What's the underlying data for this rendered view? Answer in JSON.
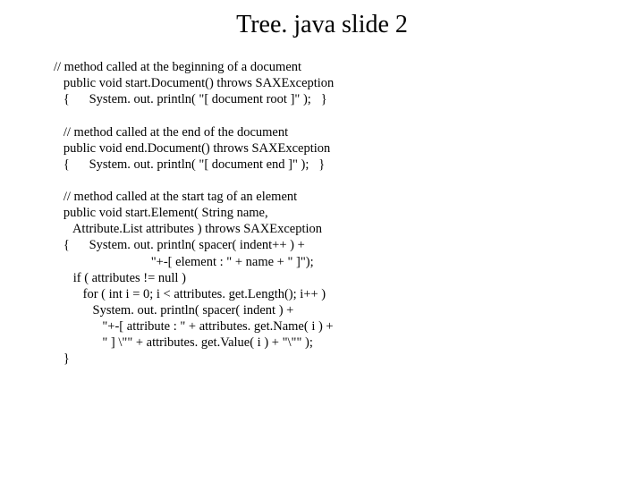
{
  "slide": {
    "title": "Tree. java slide 2",
    "code": "// method called at the beginning of a document\n   public void start.Document() throws SAXException\n   {      System. out. println( \"[ document root ]\" );   }\n\n   // method called at the end of the document\n   public void end.Document() throws SAXException\n   {      System. out. println( \"[ document end ]\" );   }\n\n   // method called at the start tag of an element\n   public void start.Element( String name,\n      Attribute.List attributes ) throws SAXException\n   {      System. out. println( spacer( indent++ ) +\n                              \"+-[ element : \" + name + \" ]\");\n      if ( attributes != null )\n         for ( int i = 0; i < attributes. get.Length(); i++ )\n            System. out. println( spacer( indent ) +\n               \"+-[ attribute : \" + attributes. get.Name( i ) +\n               \" ] \\\"\" + attributes. get.Value( i ) + \"\\\"\" );   \n   }"
  }
}
